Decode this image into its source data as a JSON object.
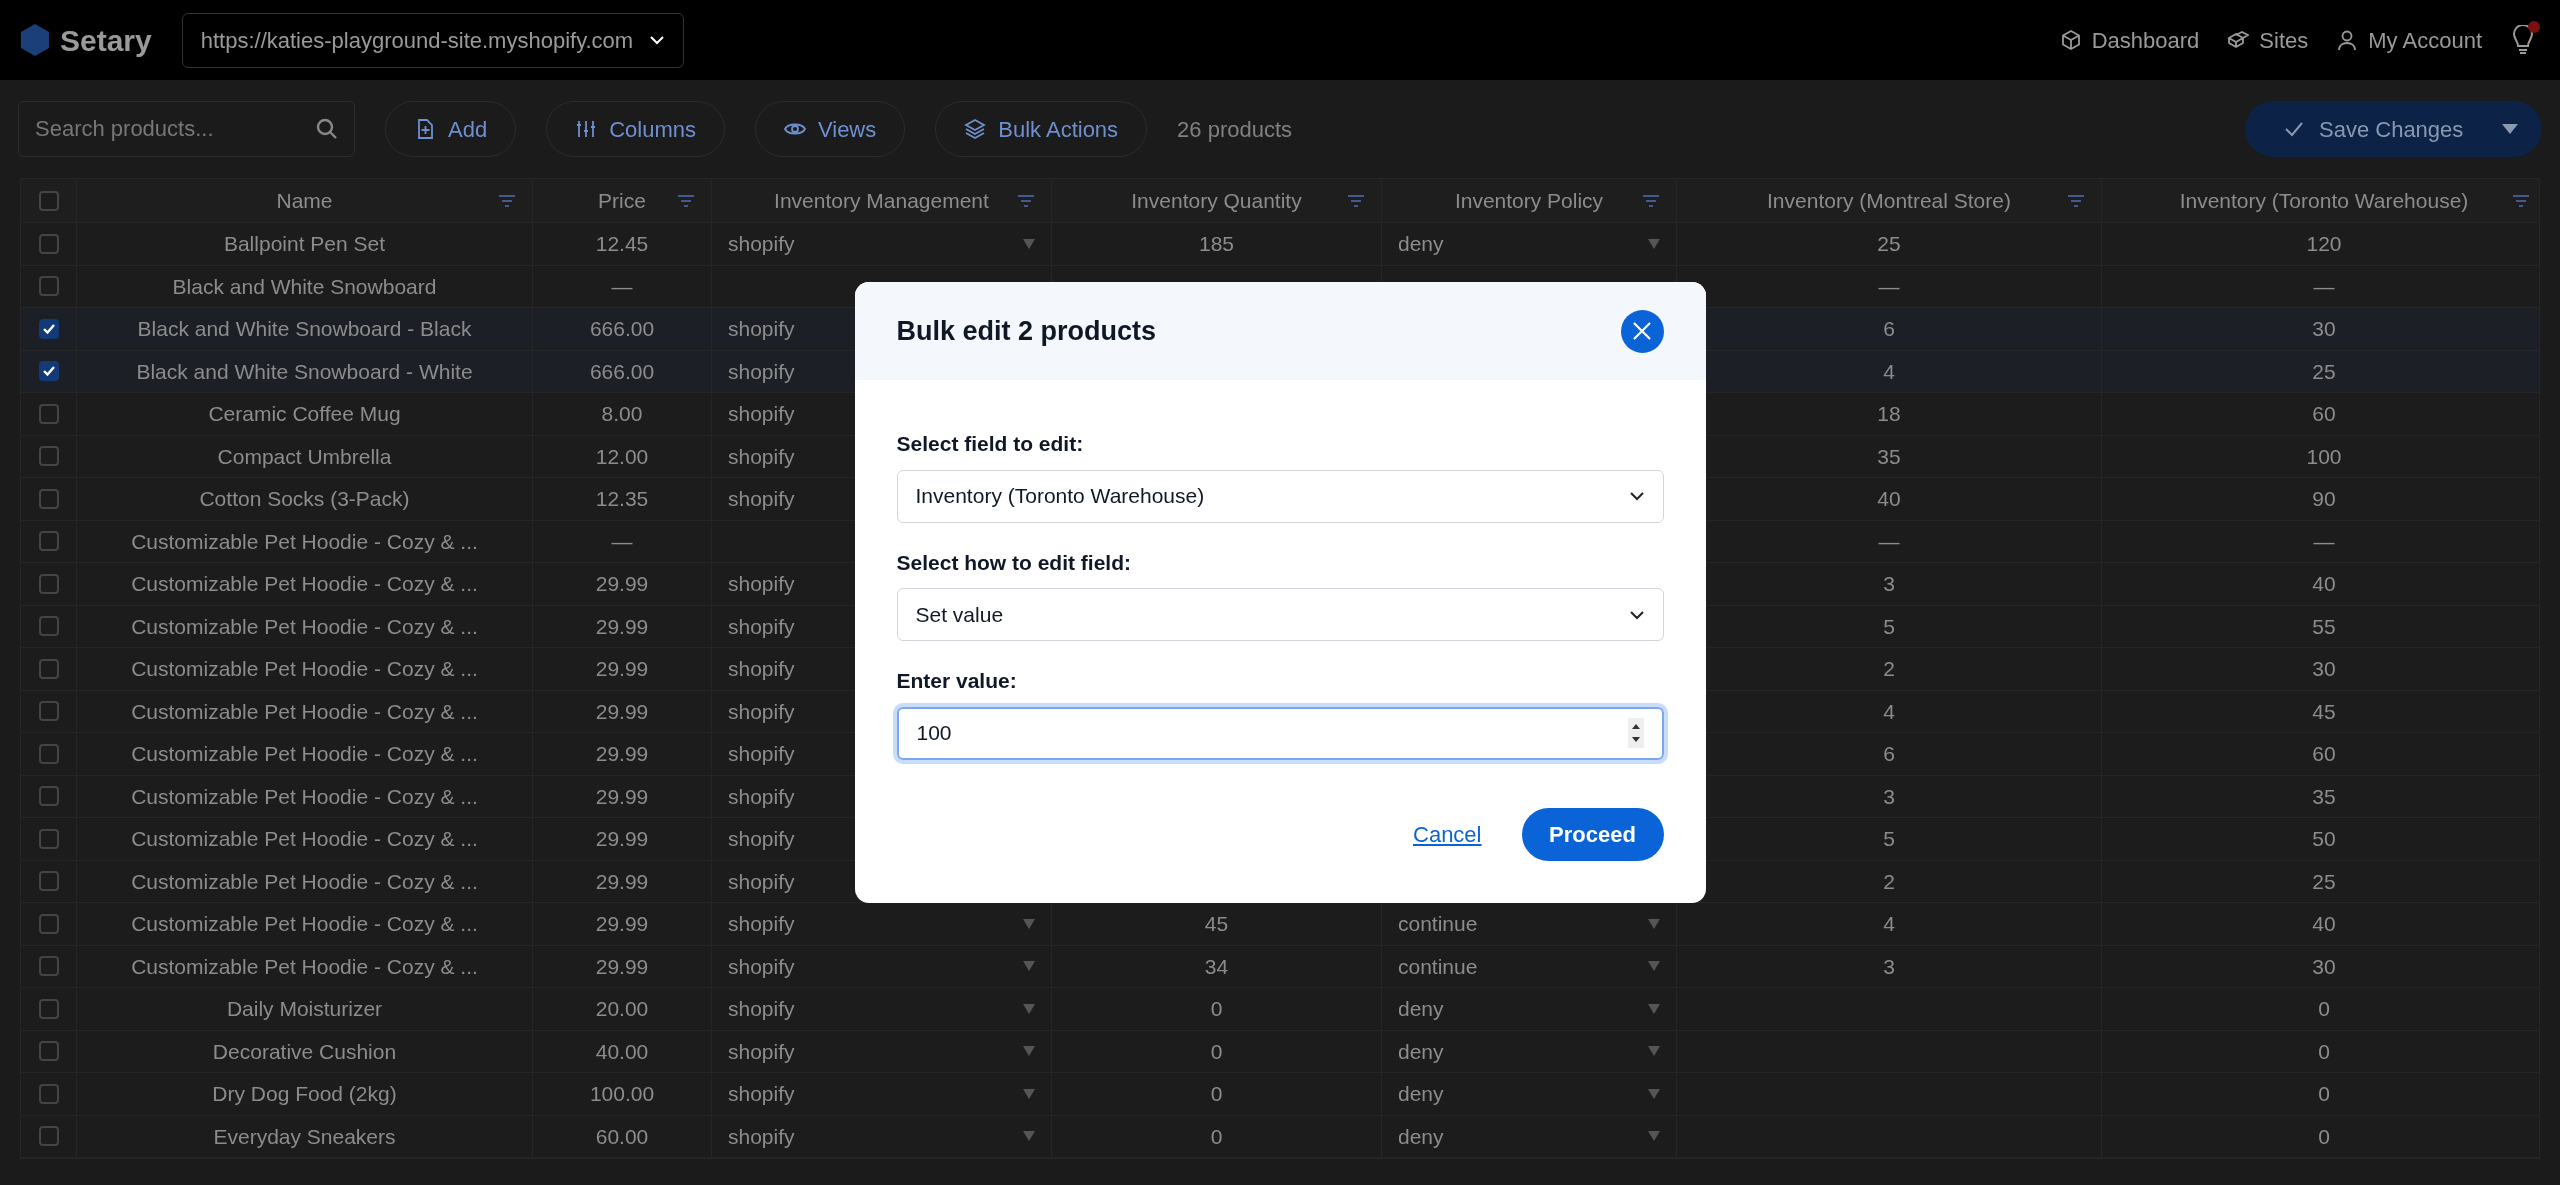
{
  "app": {
    "logo": "Setary",
    "site": "https://katies-playground-site.myshopify.com",
    "nav": [
      {
        "label": "Dashboard",
        "kind": "cube"
      },
      {
        "label": "Sites",
        "kind": "cubes"
      },
      {
        "label": "My Account",
        "kind": "user"
      }
    ],
    "notification_dot": true
  },
  "toolbar": {
    "search": {
      "placeholder": "Search products..."
    },
    "buttons": [
      {
        "label": "Add",
        "kind": "add"
      },
      {
        "label": "Columns",
        "kind": "columns"
      },
      {
        "label": "Views",
        "kind": "eye"
      },
      {
        "label": "Bulk Actions",
        "kind": "layers"
      }
    ],
    "count": "26 products",
    "save": "Save Changes"
  },
  "table": {
    "select_all": false,
    "columns": [
      "Name",
      "Price",
      "Inventory Management",
      "Inventory Quantity",
      "Inventory Policy",
      "Inventory (Montreal Store)",
      "Inventory (Toronto Warehouse)"
    ],
    "rows": [
      {
        "selected": false,
        "name": "Ballpoint Pen Set",
        "price": "12.45",
        "management": "shopify",
        "quantity": "185",
        "policy": "deny",
        "montreal": "25",
        "toronto": "120"
      },
      {
        "selected": false,
        "name": "Black and White Snowboard",
        "price": "—",
        "montreal": "—",
        "toronto": "—"
      },
      {
        "selected": true,
        "name": "Black and White Snowboard - Black",
        "price": "666.00",
        "management": "shopify",
        "montreal": "6",
        "toronto": "30"
      },
      {
        "selected": true,
        "name": "Black and White Snowboard - White",
        "price": "666.00",
        "management": "shopify",
        "montreal": "4",
        "toronto": "25"
      },
      {
        "selected": false,
        "name": "Ceramic Coffee Mug",
        "price": "8.00",
        "management": "shopify",
        "montreal": "18",
        "toronto": "60"
      },
      {
        "selected": false,
        "name": "Compact Umbrella",
        "price": "12.00",
        "management": "shopify",
        "montreal": "35",
        "toronto": "100"
      },
      {
        "selected": false,
        "name": "Cotton Socks (3-Pack)",
        "price": "12.35",
        "management": "shopify",
        "montreal": "40",
        "toronto": "90"
      },
      {
        "selected": false,
        "name": "Customizable Pet Hoodie - Cozy & ...",
        "price": "—",
        "montreal": "—",
        "toronto": "—"
      },
      {
        "selected": false,
        "name": "Customizable Pet Hoodie - Cozy & ...",
        "price": "29.99",
        "management": "shopify",
        "montreal": "3",
        "toronto": "40"
      },
      {
        "selected": false,
        "name": "Customizable Pet Hoodie - Cozy & ...",
        "price": "29.99",
        "management": "shopify",
        "montreal": "5",
        "toronto": "55"
      },
      {
        "selected": false,
        "name": "Customizable Pet Hoodie - Cozy & ...",
        "price": "29.99",
        "management": "shopify",
        "montreal": "2",
        "toronto": "30"
      },
      {
        "selected": false,
        "name": "Customizable Pet Hoodie - Cozy & ...",
        "price": "29.99",
        "management": "shopify",
        "montreal": "4",
        "toronto": "45"
      },
      {
        "selected": false,
        "name": "Customizable Pet Hoodie - Cozy & ...",
        "price": "29.99",
        "management": "shopify",
        "montreal": "6",
        "toronto": "60"
      },
      {
        "selected": false,
        "name": "Customizable Pet Hoodie - Cozy & ...",
        "price": "29.99",
        "management": "shopify",
        "montreal": "3",
        "toronto": "35"
      },
      {
        "selected": false,
        "name": "Customizable Pet Hoodie - Cozy & ...",
        "price": "29.99",
        "management": "shopify",
        "montreal": "5",
        "toronto": "50"
      },
      {
        "selected": false,
        "name": "Customizable Pet Hoodie - Cozy & ...",
        "price": "29.99",
        "management": "shopify",
        "montreal": "2",
        "toronto": "25"
      },
      {
        "selected": false,
        "name": "Customizable Pet Hoodie - Cozy & ...",
        "price": "29.99",
        "management": "shopify",
        "quantity": "45",
        "policy": "continue",
        "montreal": "4",
        "toronto": "40"
      },
      {
        "selected": false,
        "name": "Customizable Pet Hoodie - Cozy & ...",
        "price": "29.99",
        "management": "shopify",
        "quantity": "34",
        "policy": "continue",
        "montreal": "3",
        "toronto": "30"
      },
      {
        "selected": false,
        "name": "Daily Moisturizer",
        "price": "20.00",
        "management": "shopify",
        "quantity": "0",
        "policy": "deny",
        "toronto": "0"
      },
      {
        "selected": false,
        "name": "Decorative Cushion",
        "price": "40.00",
        "management": "shopify",
        "quantity": "0",
        "policy": "deny",
        "toronto": "0"
      },
      {
        "selected": false,
        "name": "Dry Dog Food (2kg)",
        "price": "100.00",
        "management": "shopify",
        "quantity": "0",
        "policy": "deny",
        "toronto": "0"
      },
      {
        "selected": false,
        "name": "Everyday Sneakers",
        "price": "60.00",
        "management": "shopify",
        "quantity": "0",
        "policy": "deny",
        "toronto": "0"
      }
    ]
  },
  "modal": {
    "title": "Bulk edit 2 products",
    "fields": [
      {
        "kind": "select",
        "label": "Select field to edit:",
        "value": "Inventory (Toronto Warehouse)"
      },
      {
        "kind": "select",
        "label": "Select how to edit field:",
        "value": "Set value"
      },
      {
        "kind": "number",
        "label": "Enter value:",
        "value": "100",
        "focused": true
      }
    ],
    "cancel": "Cancel",
    "proceed": "Proceed"
  }
}
